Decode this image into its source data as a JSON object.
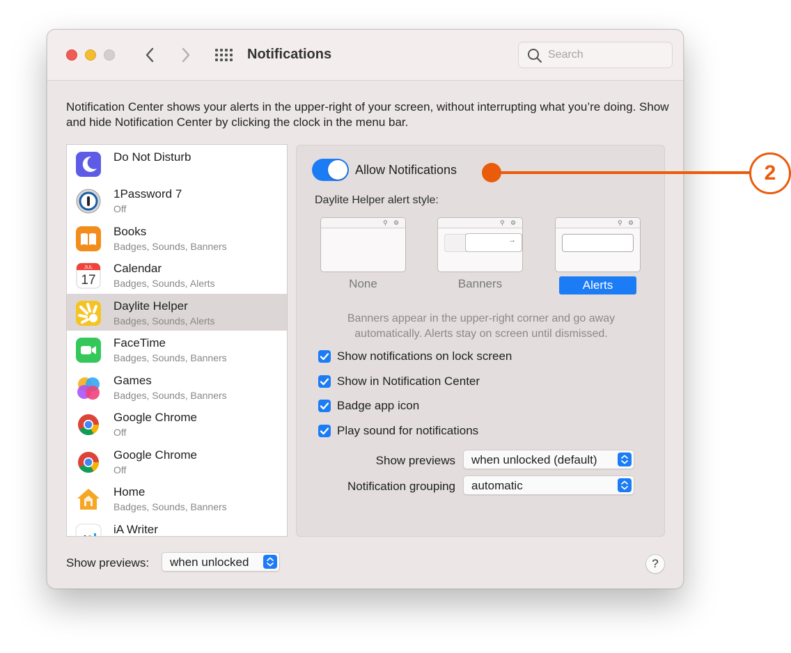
{
  "window": {
    "title": "Notifications",
    "search_placeholder": "Search"
  },
  "description": "Notification Center shows your alerts in the upper-right of your screen, without interrupting what you’re doing. Show and hide Notification Center by clicking the clock in the menu bar.",
  "apps": [
    {
      "name": "Do Not Disturb",
      "subtitle": "",
      "icon": "moon-icon"
    },
    {
      "name": "1Password 7",
      "subtitle": "Off",
      "icon": "1password-icon"
    },
    {
      "name": "Books",
      "subtitle": "Badges, Sounds, Banners",
      "icon": "books-icon"
    },
    {
      "name": "Calendar",
      "subtitle": "Badges, Sounds, Alerts",
      "icon": "calendar-icon",
      "icon_month": "JUL",
      "icon_day": "17"
    },
    {
      "name": "Daylite Helper",
      "subtitle": "Badges, Sounds, Alerts",
      "icon": "daylite-icon",
      "selected": true
    },
    {
      "name": "FaceTime",
      "subtitle": "Badges, Sounds, Banners",
      "icon": "facetime-icon"
    },
    {
      "name": "Games",
      "subtitle": "Badges, Sounds, Banners",
      "icon": "games-icon"
    },
    {
      "name": "Google Chrome",
      "subtitle": "Off",
      "icon": "chrome-icon"
    },
    {
      "name": "Google Chrome",
      "subtitle": "Off",
      "icon": "chrome-icon"
    },
    {
      "name": "Home",
      "subtitle": "Badges, Sounds, Banners",
      "icon": "home-icon"
    },
    {
      "name": "iA Writer",
      "subtitle": "",
      "icon": "ia-writer-icon",
      "icon_text": "iA"
    }
  ],
  "detail": {
    "allow_label": "Allow Notifications",
    "allow_enabled": true,
    "alert_style_label": "Daylite Helper alert style:",
    "styles": [
      {
        "label": "None",
        "selected": false
      },
      {
        "label": "Banners",
        "selected": false
      },
      {
        "label": "Alerts",
        "selected": true
      }
    ],
    "help_text": "Banners appear in the upper-right corner and go away automatically. Alerts stay on screen until dismissed.",
    "checkboxes": [
      {
        "label": "Show notifications on lock screen",
        "checked": true
      },
      {
        "label": "Show in Notification Center",
        "checked": true
      },
      {
        "label": "Badge app icon",
        "checked": true
      },
      {
        "label": "Play sound for notifications",
        "checked": true
      }
    ],
    "show_previews_label": "Show previews",
    "show_previews_value": "when unlocked (default)",
    "grouping_label": "Notification grouping",
    "grouping_value": "automatic"
  },
  "bottom": {
    "show_previews_label": "Show previews:",
    "show_previews_value": "when unlocked",
    "help_label": "?"
  },
  "callout": {
    "number": "2"
  },
  "colors": {
    "accent": "#1b7cf5",
    "callout": "#ea5b0c"
  }
}
